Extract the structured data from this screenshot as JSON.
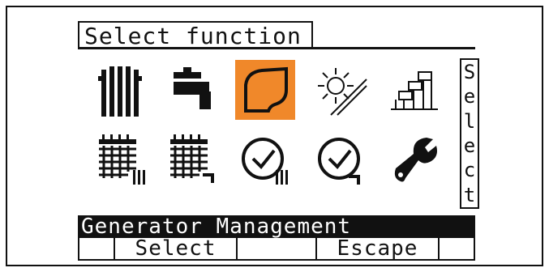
{
  "screen": {
    "title": "Select function",
    "side_label": [
      "S",
      "e",
      "l",
      "e",
      "c",
      "t"
    ],
    "status": "Generator Management",
    "softkeys": [
      "",
      "Select",
      "",
      "Escape",
      ""
    ]
  },
  "icons": [
    {
      "name": "radiator-icon"
    },
    {
      "name": "tap-icon"
    },
    {
      "name": "generator-icon",
      "selected": true
    },
    {
      "name": "solar-icon"
    },
    {
      "name": "pipe-network-icon"
    },
    {
      "name": "calendar-radiator-icon"
    },
    {
      "name": "calendar-tap-icon"
    },
    {
      "name": "clock-radiator-icon"
    },
    {
      "name": "clock-tap-icon"
    },
    {
      "name": "wrench-icon"
    }
  ],
  "colors": {
    "selection": "#f0882a",
    "foreground": "#111111",
    "background": "#ffffff"
  }
}
